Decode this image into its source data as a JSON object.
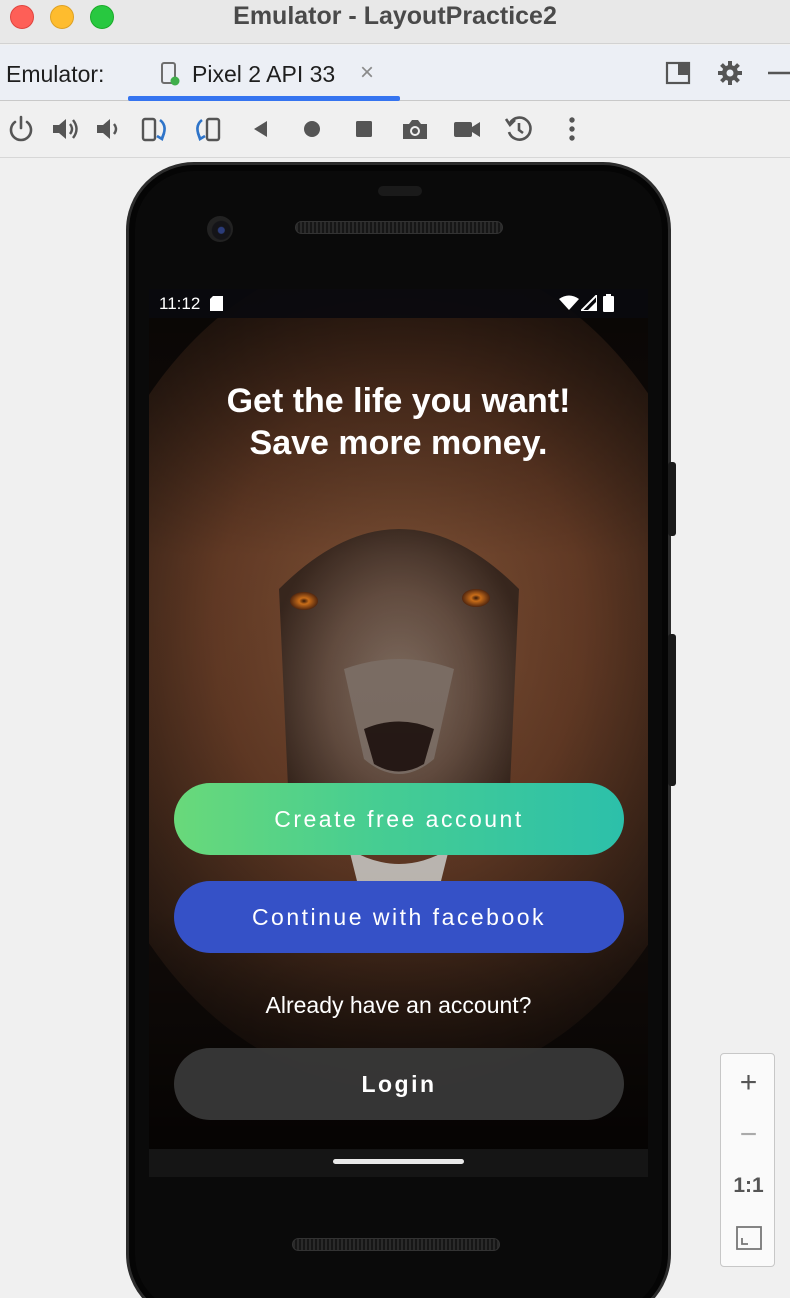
{
  "window": {
    "title": "Emulator - LayoutPractice2"
  },
  "tabbar": {
    "label": "Emulator:",
    "device_tab": "Pixel 2 API 33",
    "close_glyph": "×"
  },
  "toolbar": {
    "buttons": [
      "power-icon",
      "volume-up-icon",
      "volume-down-icon",
      "rotate-left-icon",
      "rotate-right-icon",
      "back-icon",
      "home-icon",
      "overview-icon",
      "screenshot-icon",
      "screen-record-icon",
      "snapshot-icon",
      "more-icon"
    ]
  },
  "phone": {
    "status": {
      "time": "11:12"
    },
    "headline": {
      "line1": "Get the life you want!",
      "line2": "Save more money."
    },
    "buttons": {
      "create": "Create free account",
      "facebook": "Continue with facebook",
      "login": "Login"
    },
    "already_text": "Already have an account?"
  },
  "zoom": {
    "zoom_in": "+",
    "zoom_out": "−",
    "actual_size": "1:1"
  },
  "colors": {
    "create_gradient_start": "#69d97a",
    "create_gradient_end": "#2cc0aa",
    "facebook_blue": "#3551c7",
    "login_gray": "#3a3a3a",
    "tab_accent": "#3574f0"
  }
}
